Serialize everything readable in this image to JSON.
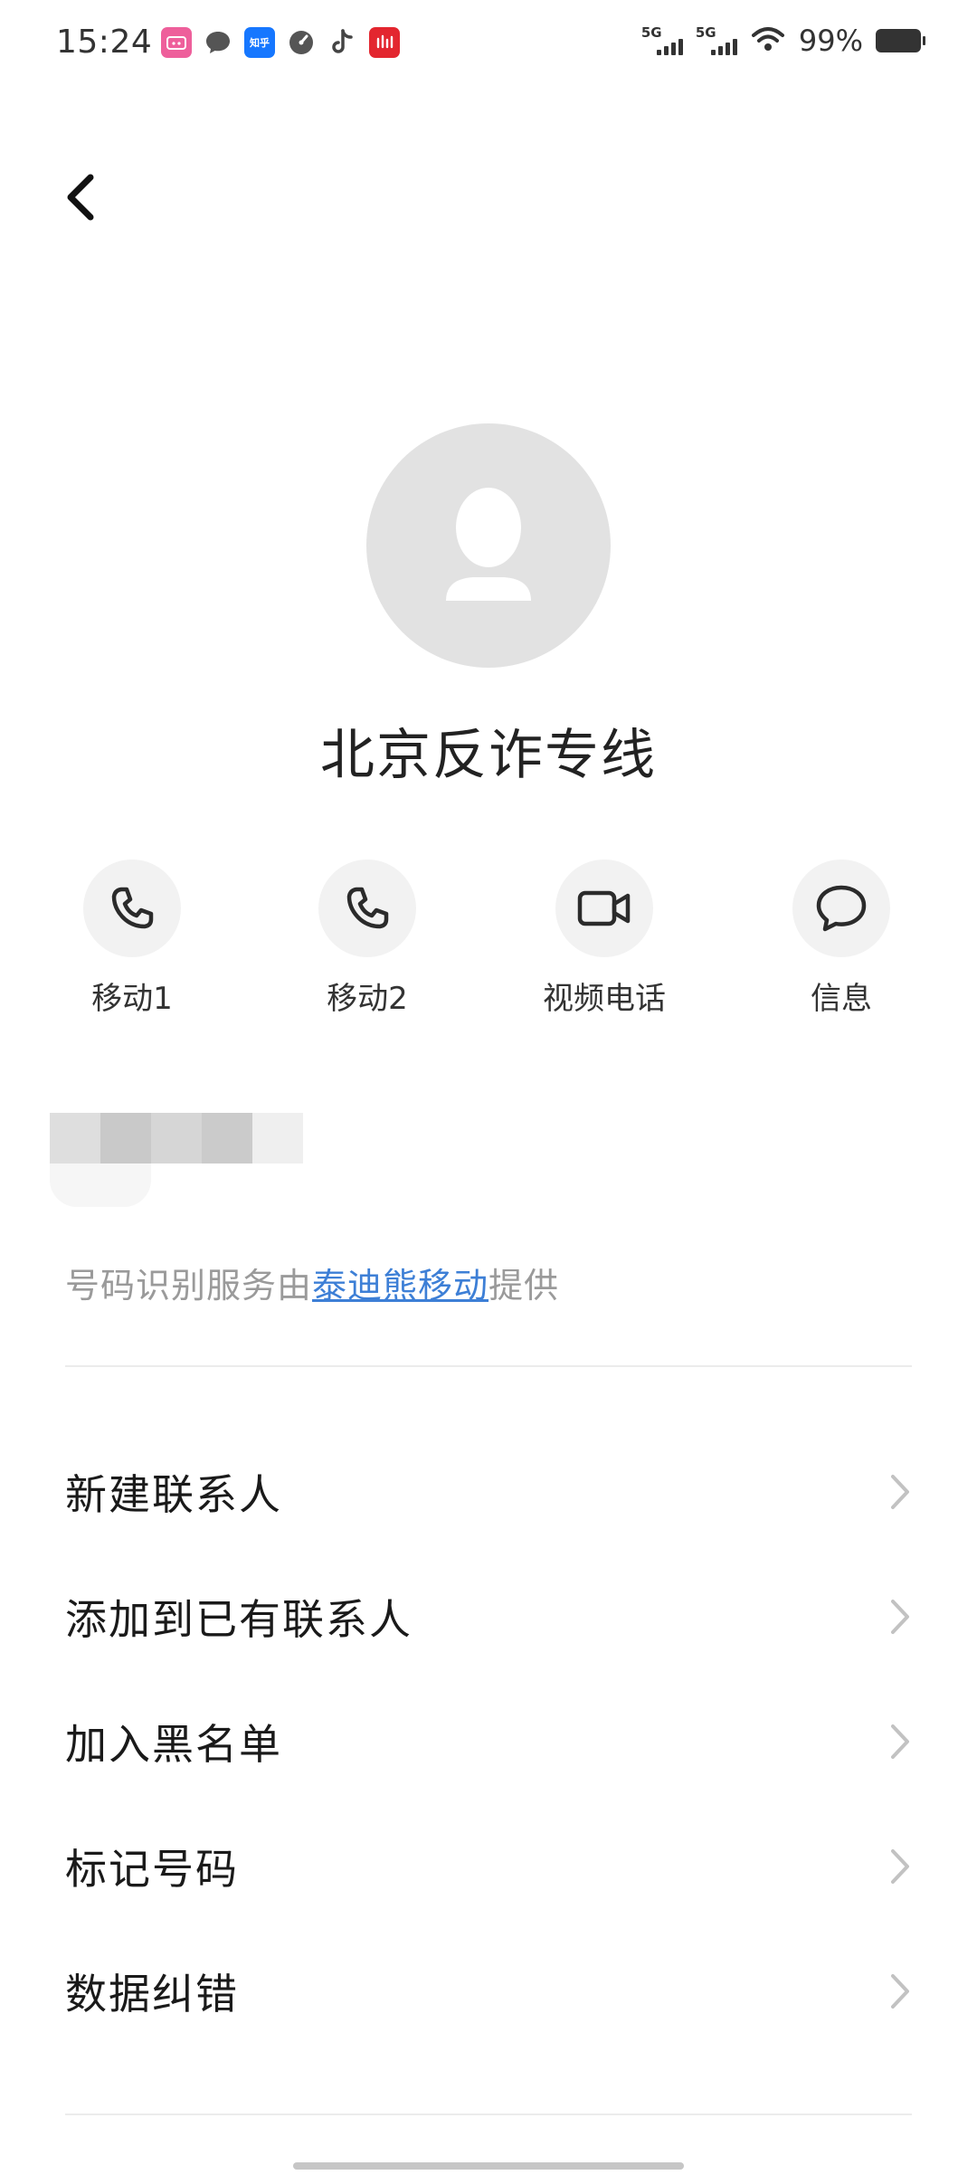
{
  "status_bar": {
    "time": "15:24",
    "notifications": [
      "bilibili-icon",
      "chat-bubble-icon",
      "zhihu-icon",
      "speed-icon",
      "tiktok-icon",
      "red-app-icon"
    ],
    "zhihu_label": "知乎",
    "network_1": "5G",
    "network_2": "5G",
    "battery_percent": "99%"
  },
  "contact": {
    "name": "北京反诈专线"
  },
  "actions": [
    {
      "label": "移动1",
      "icon": "phone-icon"
    },
    {
      "label": "移动2",
      "icon": "phone-icon"
    },
    {
      "label": "视频电话",
      "icon": "video-camera-icon"
    },
    {
      "label": "信息",
      "icon": "message-bubble-icon"
    }
  ],
  "id_service": {
    "prefix": "号码识别服务由",
    "provider": "泰迪熊移动",
    "suffix": "提供"
  },
  "menu": [
    {
      "label": "新建联系人"
    },
    {
      "label": "添加到已有联系人"
    },
    {
      "label": "加入黑名单"
    },
    {
      "label": "标记号码"
    },
    {
      "label": "数据纠错"
    }
  ],
  "colors": {
    "link": "#3d7fd6",
    "avatar_bg": "#e2e2e2",
    "action_bg": "#f2f2f2"
  }
}
